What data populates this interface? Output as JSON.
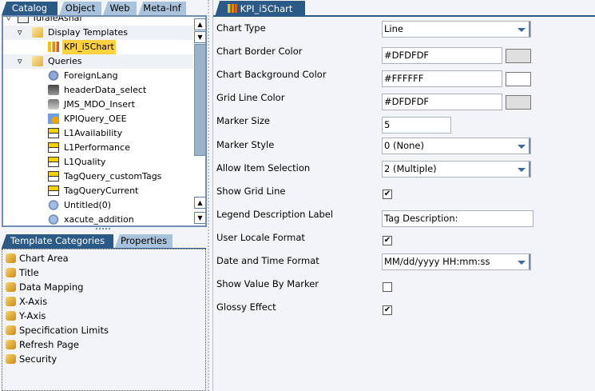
{
  "left_tabs": [
    "Catalog",
    "Object",
    "Web",
    "Meta-Inf"
  ],
  "tree": {
    "root": "TufaleAshai",
    "items": [
      {
        "label": "Display Templates",
        "type": "folder",
        "level": 1
      },
      {
        "label": "KPI_i5Chart",
        "type": "chart",
        "level": 2,
        "selected": true
      },
      {
        "label": "Queries",
        "type": "folder",
        "level": 1
      },
      {
        "label": "ForeignLang",
        "type": "gear",
        "level": 2
      },
      {
        "label": "headerData_select",
        "type": "sql",
        "level": 2
      },
      {
        "label": "JMS_MDO_Insert",
        "type": "db",
        "level": 2
      },
      {
        "label": "KPIQuery_OEE",
        "type": "kpi",
        "level": 2
      },
      {
        "label": "L1Availability",
        "type": "tag",
        "level": 2
      },
      {
        "label": "L1Performance",
        "type": "tag",
        "level": 2
      },
      {
        "label": "L1Quality",
        "type": "tag",
        "level": 2
      },
      {
        "label": "TagQuery_customTags",
        "type": "tag",
        "level": 2
      },
      {
        "label": "TagQueryCurrent",
        "type": "tag",
        "level": 2
      },
      {
        "label": "Untitled(0)",
        "type": "xacute",
        "level": 2
      },
      {
        "label": "xacute_addition",
        "type": "xacute",
        "level": 2
      }
    ]
  },
  "bottom_tabs": [
    "Template Categories",
    "Properties"
  ],
  "categories": [
    "Chart Area",
    "Title",
    "Data Mapping",
    "X-Axis",
    "Y-Axis",
    "Specification Limits",
    "Refresh Page",
    "Security"
  ],
  "editor_tab": "KPI_i5Chart",
  "properties": [
    {
      "label": "Chart Type",
      "kind": "select",
      "value": "Line"
    },
    {
      "label": "Chart Border Color",
      "kind": "color",
      "value": "#DFDFDF",
      "swatch": "#DFDFDF"
    },
    {
      "label": "Chart Background Color",
      "kind": "color",
      "value": "#FFFFFF",
      "swatch": "#FFFFFF"
    },
    {
      "label": "Grid Line Color",
      "kind": "color",
      "value": "#DFDFDF",
      "swatch": "#DFDFDF"
    },
    {
      "label": "Marker Size",
      "kind": "text",
      "value": "5"
    },
    {
      "label": "Marker Style",
      "kind": "select",
      "value": "0 (None)"
    },
    {
      "label": "Allow Item Selection",
      "kind": "select",
      "value": "2 (Multiple)"
    },
    {
      "label": "Show Grid Line",
      "kind": "check",
      "checked": true
    },
    {
      "label": "Legend Description Label",
      "kind": "wide",
      "value": "Tag Description:"
    },
    {
      "label": "User Locale Format",
      "kind": "check",
      "checked": true
    },
    {
      "label": "Date and Time Format",
      "kind": "select",
      "value": "MM/dd/yyyy HH:mm:ss"
    },
    {
      "label": "Show Value By Marker",
      "kind": "check",
      "checked": false
    },
    {
      "label": "Glossy Effect",
      "kind": "check",
      "checked": true
    }
  ]
}
